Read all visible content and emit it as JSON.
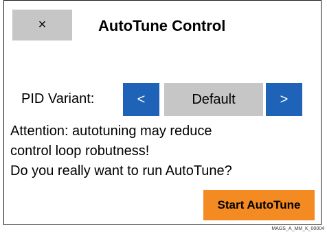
{
  "dialog": {
    "close_label": "×",
    "title": "AutoTune Control"
  },
  "pid": {
    "label": "PID Variant:",
    "prev_label": "<",
    "value": "Default",
    "next_label": ">"
  },
  "warning": {
    "lines": [
      "Attention: autotuning may reduce",
      "control loop robutness!",
      "Do you really want to run AutoTune?"
    ]
  },
  "actions": {
    "start_label": "Start AutoTune"
  },
  "footer": {
    "doc_id": "MAGS_A_MM_K_00004"
  },
  "colors": {
    "primary_blue": "#1e63b8",
    "neutral_gray": "#c6c6c6",
    "accent_orange": "#f38a22"
  }
}
